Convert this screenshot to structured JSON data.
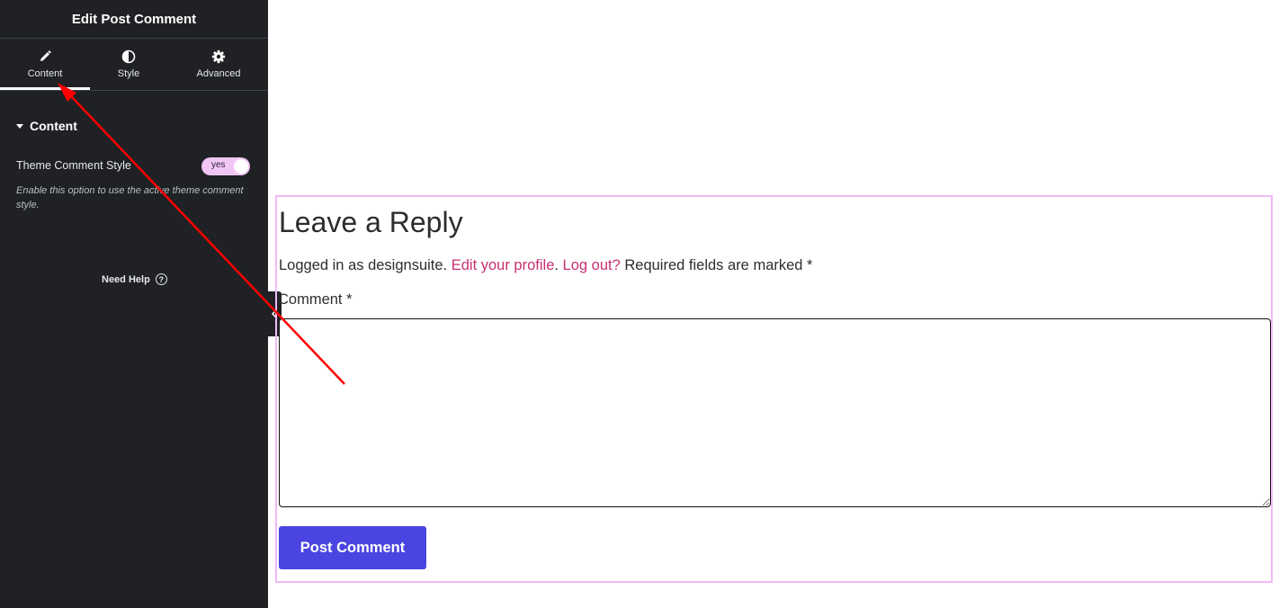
{
  "panel": {
    "title": "Edit Post Comment",
    "tabs": [
      {
        "label": "Content",
        "icon": "pencil-icon",
        "active": true
      },
      {
        "label": "Style",
        "icon": "half-circle-icon",
        "active": false
      },
      {
        "label": "Advanced",
        "icon": "gear-icon",
        "active": false
      }
    ],
    "section": {
      "title": "Content",
      "expanded": true
    },
    "control": {
      "label": "Theme Comment Style",
      "toggle_text": "yes",
      "toggle_on": true,
      "description": "Enable this option to use the active theme comment style."
    },
    "help": {
      "label": "Need Help",
      "icon": "question-circle-icon"
    }
  },
  "preview": {
    "reply_title": "Leave a Reply",
    "logged_in_prefix": "Logged in as designsuite. ",
    "edit_profile_link": "Edit your profile",
    "separator": ". ",
    "logout_link": "Log out?",
    "required_note": " Required fields are marked *",
    "comment_label": "Comment *",
    "submit_label": "Post Comment"
  },
  "colors": {
    "panel_bg": "#1f2124",
    "toggle_bg": "#f0c6f5",
    "link": "#c82f72",
    "button": "#4a45e0",
    "widget_outline": "#f2b9f7",
    "annotation_arrow": "#ff0000"
  }
}
